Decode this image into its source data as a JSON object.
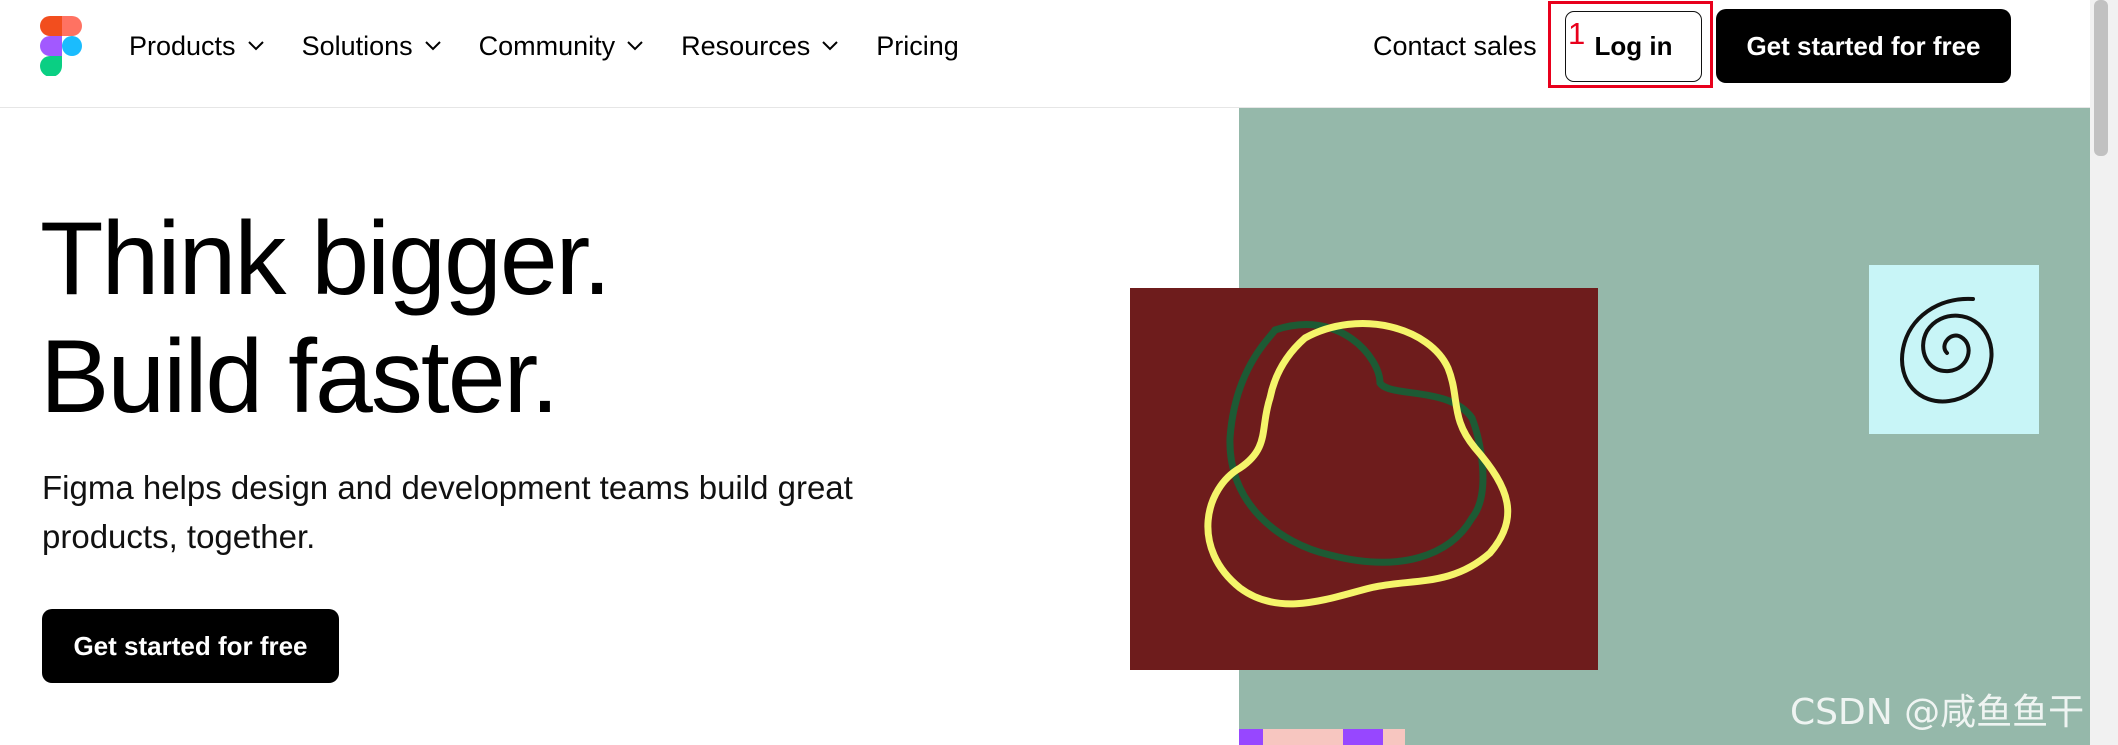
{
  "nav": {
    "items": [
      {
        "label": "Products",
        "dropdown": true
      },
      {
        "label": "Solutions",
        "dropdown": true
      },
      {
        "label": "Community",
        "dropdown": true
      },
      {
        "label": "Resources",
        "dropdown": true
      },
      {
        "label": "Pricing",
        "dropdown": false
      }
    ],
    "contact_label": "Contact sales",
    "login_label": "Log in",
    "cta_label": "Get started for free"
  },
  "annotation": {
    "marker": "1",
    "color": "#e8001c"
  },
  "hero": {
    "title_line1": "Think bigger.",
    "title_line2": "Build faster.",
    "subtitle": "Figma helps design and development teams build great products, together.",
    "cta_label": "Get started for free"
  },
  "watermark": "CSDN @咸鱼鱼干",
  "colors": {
    "art_background": "#95b8aa",
    "art_maroon": "#6e1c1c",
    "art_cyan": "#c8f5f7",
    "yellow_stroke": "#f5f56a",
    "green_stroke": "#1d5a34"
  },
  "icons": {
    "logo": "figma-logo-icon",
    "dropdown": "chevron-down-icon"
  }
}
